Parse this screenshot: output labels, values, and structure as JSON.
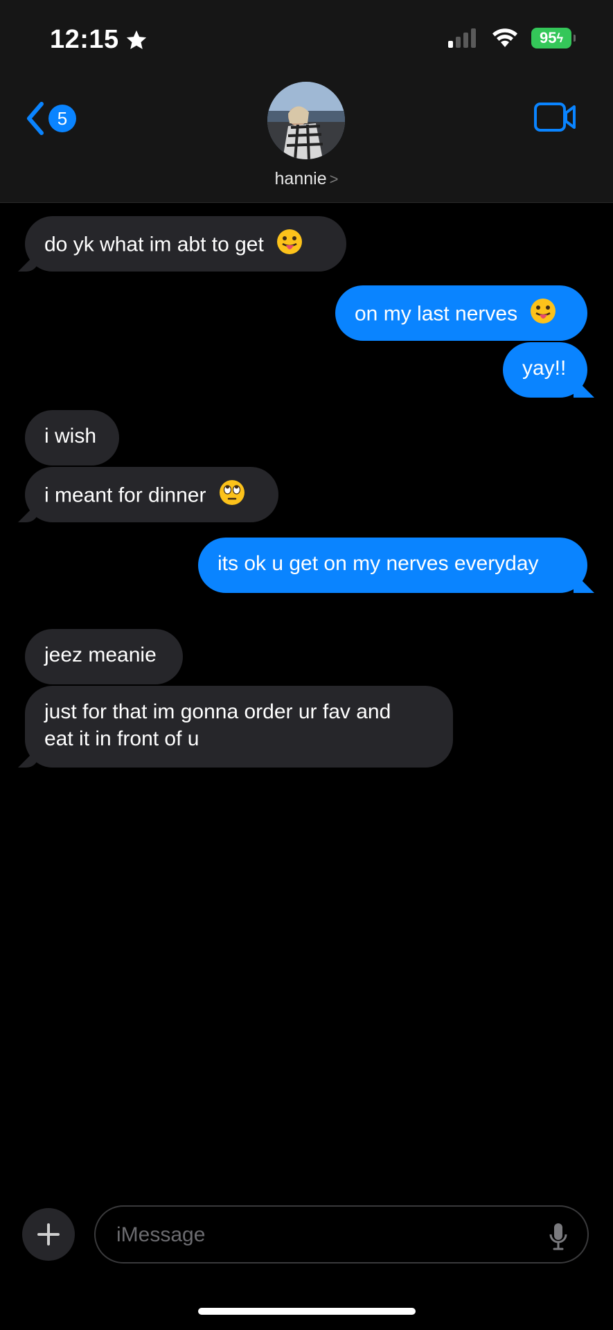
{
  "status_bar": {
    "time": "12:15",
    "battery": "95"
  },
  "header": {
    "back_badge": "5",
    "contact_name": "hannie"
  },
  "messages": [
    {
      "side": "in",
      "text": "do yk what im abt to get",
      "emoji": "tongue"
    },
    {
      "side": "out",
      "text": "on my last nerves",
      "emoji": "tongue"
    },
    {
      "side": "out",
      "text": "yay!!"
    },
    {
      "side": "in",
      "text": "i wish"
    },
    {
      "side": "in",
      "text": "i meant for dinner",
      "emoji": "eye-roll"
    },
    {
      "side": "out",
      "text": "its ok u get on my nerves everyday"
    },
    {
      "side": "in",
      "text": "jeez meanie"
    },
    {
      "side": "in",
      "text_line1": "just for that im gonna order ur fav and",
      "text_line2": "eat it in front of u"
    }
  ],
  "compose": {
    "placeholder": "iMessage"
  },
  "colors": {
    "accent": "#0a84ff",
    "incoming_bubble": "#26262a",
    "battery": "#34c759",
    "background": "#000000"
  },
  "icons": [
    "star-icon",
    "signal-icon",
    "wifi-icon",
    "battery-icon",
    "back-chevron-icon",
    "video-camera-icon",
    "plus-icon",
    "microphone-icon",
    "tongue-emoji-icon",
    "eye-roll-emoji-icon"
  ]
}
